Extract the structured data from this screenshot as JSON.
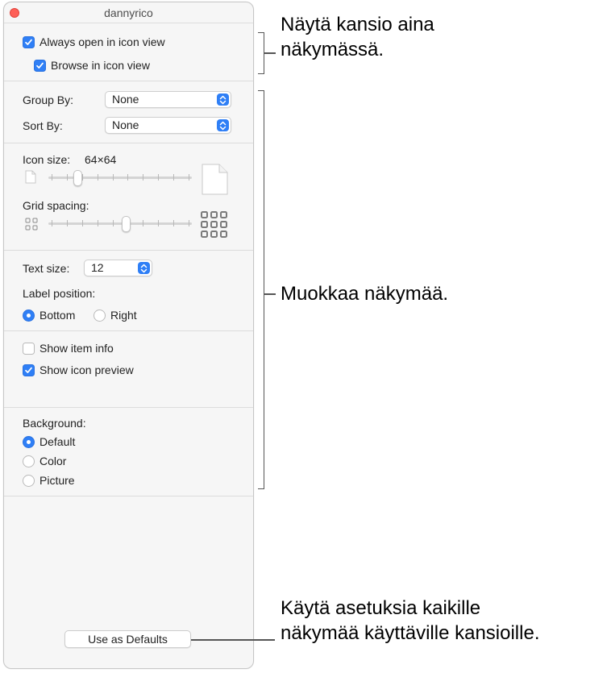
{
  "window": {
    "title": "dannyrico"
  },
  "view_options": {
    "always_open": {
      "label": "Always open in icon view",
      "checked": true
    },
    "browse": {
      "label": "Browse in icon view",
      "checked": true
    },
    "group_by": {
      "label": "Group By:",
      "value": "None"
    },
    "sort_by": {
      "label": "Sort By:",
      "value": "None"
    },
    "icon_size": {
      "label": "Icon size:",
      "value": "64×64",
      "level": 0.2
    },
    "grid_spacing": {
      "label": "Grid spacing:",
      "level": 0.54
    },
    "text_size": {
      "label": "Text size:",
      "value": "12"
    },
    "label_position": {
      "label": "Label position:",
      "options": [
        "Bottom",
        "Right"
      ],
      "selected": "Bottom"
    },
    "show_item_info": {
      "label": "Show item info",
      "checked": false
    },
    "show_icon_preview": {
      "label": "Show icon preview",
      "checked": true
    },
    "background": {
      "label": "Background:",
      "options": [
        "Default",
        "Color",
        "Picture"
      ],
      "selected": "Default"
    },
    "use_as_defaults": "Use as Defaults"
  },
  "callouts": {
    "top": [
      "Näytä kansio aina",
      "näkymässä."
    ],
    "middle": [
      "Muokkaa näkymää."
    ],
    "bottom": [
      "Käytä asetuksia kaikille",
      "näkymää käyttäville kansioille."
    ]
  },
  "colors": {
    "accent": "#2f7ff6",
    "close": "#fe5f57"
  }
}
